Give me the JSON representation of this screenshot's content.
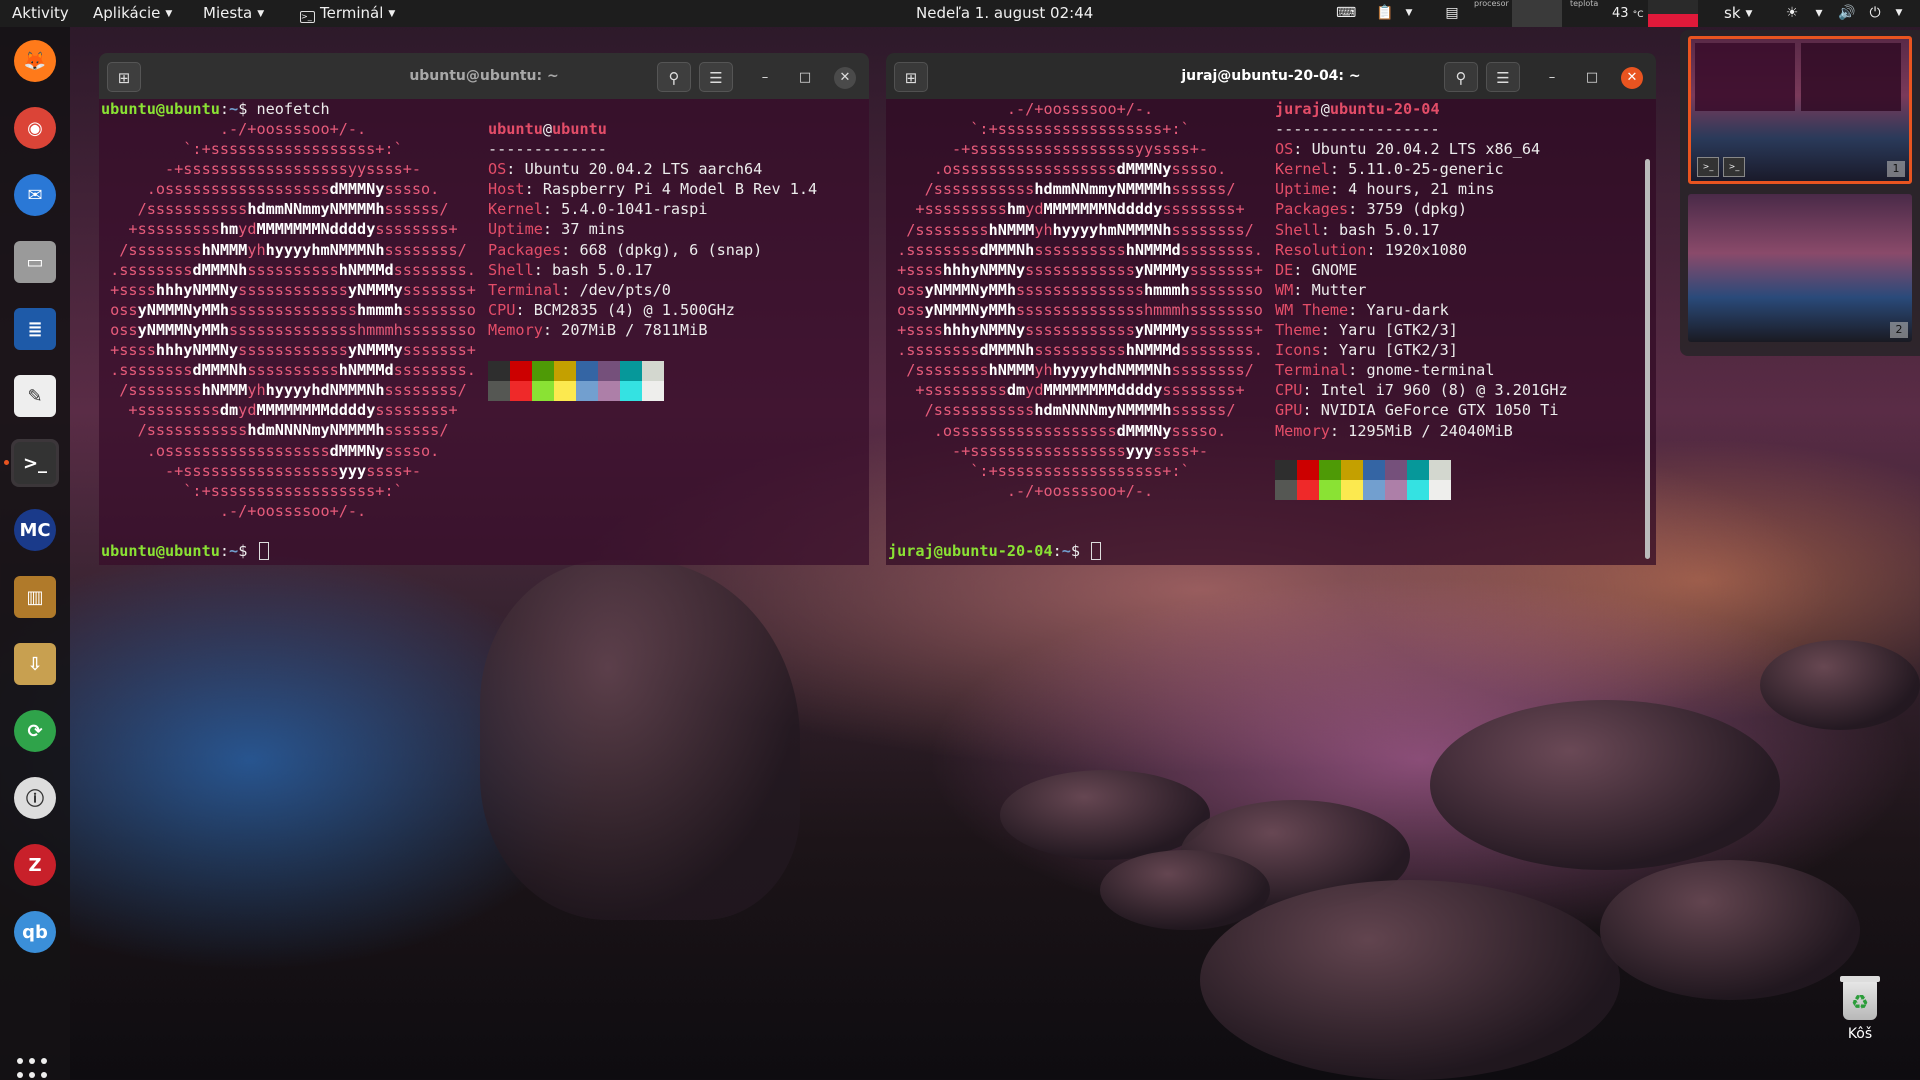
{
  "topbar": {
    "activities": "Aktivity",
    "apps_menu": "Aplikácie",
    "places_menu": "Miesta",
    "app_name": "Terminál",
    "clock": "Nedeľa  1. august  02:44",
    "cpu_label": "procesor",
    "temp_label": "teplota",
    "temp_value": "43",
    "temp_unit": "°C",
    "keyboard_layout": "sk"
  },
  "dock": {
    "items": [
      {
        "name": "firefox-icon",
        "color": "#ff7a1a"
      },
      {
        "name": "chrome-icon",
        "color": "#db4437"
      },
      {
        "name": "thunderbird-icon",
        "color": "#2a78d6"
      },
      {
        "name": "files-icon",
        "color": "#9a9a9a"
      },
      {
        "name": "libreoffice-writer-icon",
        "color": "#1e5aa8"
      },
      {
        "name": "text-editor-icon",
        "color": "#eeeeee"
      },
      {
        "name": "terminal-icon",
        "color": "#333333"
      },
      {
        "name": "midnight-commander-icon",
        "color": "#1a3a8a"
      },
      {
        "name": "library-books-icon",
        "color": "#b07a2a"
      },
      {
        "name": "archive-manager-icon",
        "color": "#c8a050"
      },
      {
        "name": "sync-icon",
        "color": "#2fa34a"
      },
      {
        "name": "hardinfo-icon",
        "color": "#dddddd"
      },
      {
        "name": "zotero-icon",
        "color": "#c8202a"
      },
      {
        "name": "qbittorrent-icon",
        "color": "#3b8fd9"
      }
    ]
  },
  "term1": {
    "title": "ubuntu@ubuntu: ~",
    "command": "neofetch",
    "prompt_user": "ubuntu@ubuntu",
    "prompt_path": "~",
    "prompt_symbol": "$",
    "logo": [
      "             .-/+oossssoo+/-.",
      "         `:+ssssssssssssssssss+:`",
      "       -+ssssssssssssssssssyyssss+-",
      "     .ossssssssssssssssss#dMMMNy#sssso.",
      "    /sssssssssss#hdmmNNmmyNMMMMh#ssssss/",
      "   +sssssssss#hm#yd#MMMMMMMNddddy#ssssssss+",
      "  /ssssssss#hNMMM#yh#hyyyyhmNMMMNh#ssssssss/",
      " .ssssssss#dMMMNh#ssssssssss#hNMMMd#ssssssss.",
      " +ssss#hhhyNMMNy#ssssssssssss#yNMMMy#sssssss+",
      " oss#yNMMMNyMMh#ssssssssssssss#hmmmh#ssssssso",
      " oss#yNMMMNyMMh#sssssssssssssshmmmhssssssso",
      " +ssss#hhhyNMMNy#ssssssssssss#yNMMMy#sssssss+",
      " .ssssssss#dMMMNh#ssssssssss#hNMMMd#ssssssss.",
      "  /ssssssss#hNMMM#yh#hyyyyhdNMMMNh#ssssssss/",
      "   +sssssssss#dm#yd#MMMMMMMMddddy#ssssssss+",
      "    /sssssssssss#hdmNNNNmyNMMMMh#ssssss/",
      "     .ossssssssssssssssss#dMMMNy#sssso.",
      "       -+sssssssssssssssss#yyy#ssss+-",
      "         `:+ssssssssssssssssss+:`",
      "             .-/+oossssoo+/-."
    ],
    "info_user": "ubuntu",
    "info_host": "ubuntu",
    "separator": "-------------",
    "info": [
      {
        "key": "OS",
        "value": "Ubuntu 20.04.2 LTS aarch64"
      },
      {
        "key": "Host",
        "value": "Raspberry Pi 4 Model B Rev 1.4"
      },
      {
        "key": "Kernel",
        "value": "5.4.0-1041-raspi"
      },
      {
        "key": "Uptime",
        "value": "37 mins"
      },
      {
        "key": "Packages",
        "value": "668 (dpkg), 6 (snap)"
      },
      {
        "key": "Shell",
        "value": "bash 5.0.17"
      },
      {
        "key": "Terminal",
        "value": "/dev/pts/0"
      },
      {
        "key": "CPU",
        "value": "BCM2835 (4) @ 1.500GHz"
      },
      {
        "key": "Memory",
        "value": "207MiB / 7811MiB"
      }
    ]
  },
  "term2": {
    "title": "juraj@ubuntu-20-04: ~",
    "prompt_user": "juraj@ubuntu-20-04",
    "prompt_path": "~",
    "prompt_symbol": "$",
    "logo": [
      "             .-/+oossssoo+/-.",
      "         `:+ssssssssssssssssss+:`",
      "       -+ssssssssssssssssssyyssss+-",
      "     .ossssssssssssssssss#dMMMNy#sssso.",
      "    /sssssssssss#hdmmNNmmyNMMMMh#ssssss/",
      "   +sssssssss#hm#yd#MMMMMMMNddddy#ssssssss+",
      "  /ssssssss#hNMMM#yh#hyyyyhmNMMMNh#ssssssss/",
      " .ssssssss#dMMMNh#ssssssssss#hNMMMd#ssssssss.",
      " +ssss#hhhyNMMNy#ssssssssssss#yNMMMy#sssssss+",
      " oss#yNMMMNyMMh#ssssssssssssss#hmmmh#ssssssso",
      " oss#yNMMMNyMMh#sssssssssssssshmmmhssssssso",
      " +ssss#hhhyNMMNy#ssssssssssss#yNMMMy#sssssss+",
      " .ssssssss#dMMMNh#ssssssssss#hNMMMd#ssssssss.",
      "  /ssssssss#hNMMM#yh#hyyyyhdNMMMNh#ssssssss/",
      "   +sssssssss#dm#yd#MMMMMMMMddddy#ssssssss+",
      "    /sssssssssss#hdmNNNNmyNMMMMh#ssssss/",
      "     .ossssssssssssssssss#dMMMNy#sssso.",
      "       -+sssssssssssssssss#yyy#ssss+-",
      "         `:+ssssssssssssssssss+:`",
      "             .-/+oossssoo+/-."
    ],
    "info_user": "juraj",
    "info_host": "ubuntu-20-04",
    "separator": "------------------",
    "info": [
      {
        "key": "OS",
        "value": "Ubuntu 20.04.2 LTS x86_64"
      },
      {
        "key": "Kernel",
        "value": "5.11.0-25-generic"
      },
      {
        "key": "Uptime",
        "value": "4 hours, 21 mins"
      },
      {
        "key": "Packages",
        "value": "3759 (dpkg)"
      },
      {
        "key": "Shell",
        "value": "bash 5.0.17"
      },
      {
        "key": "Resolution",
        "value": "1920x1080"
      },
      {
        "key": "DE",
        "value": "GNOME"
      },
      {
        "key": "WM",
        "value": "Mutter"
      },
      {
        "key": "WM Theme",
        "value": "Yaru-dark"
      },
      {
        "key": "Theme",
        "value": "Yaru [GTK2/3]"
      },
      {
        "key": "Icons",
        "value": "Yaru [GTK2/3]"
      },
      {
        "key": "Terminal",
        "value": "gnome-terminal"
      },
      {
        "key": "CPU",
        "value": "Intel i7 960 (8) @ 3.201GHz"
      },
      {
        "key": "GPU",
        "value": "NVIDIA GeForce GTX 1050 Ti"
      },
      {
        "key": "Memory",
        "value": "1295MiB / 24040MiB"
      }
    ]
  },
  "palette": [
    "#2e2e2e",
    "#cc0000",
    "#4e9a06",
    "#c4a000",
    "#3465a4",
    "#75507b",
    "#06989a",
    "#d3d7cf",
    "#555753",
    "#ef2929",
    "#8ae234",
    "#fce94f",
    "#729fcf",
    "#ad7fa8",
    "#34e2e2",
    "#eeeeec"
  ],
  "workspaces": [
    {
      "number": "1",
      "active": true
    },
    {
      "number": "2",
      "active": false
    }
  ],
  "trash": {
    "label": "Kôš"
  },
  "colors": {
    "accent": "#e95420",
    "term1_bg": "#380c2a",
    "term2_bg": "#300a24"
  }
}
